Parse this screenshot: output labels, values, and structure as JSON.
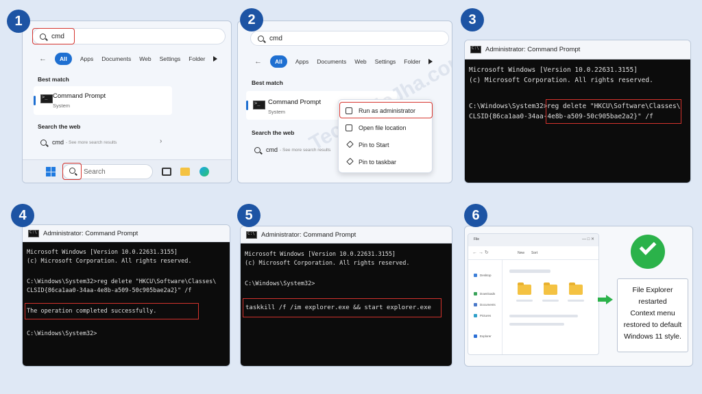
{
  "steps": [
    "1",
    "2",
    "3",
    "4",
    "5",
    "6"
  ],
  "search": {
    "query": "cmd",
    "filters": [
      "All",
      "Apps",
      "Documents",
      "Web",
      "Settings",
      "Folder"
    ],
    "best_match_label": "Best match",
    "result_title": "Command Prompt",
    "result_subtitle": "System",
    "search_web_label": "Search the web",
    "web_query": "cmd",
    "web_hint": "- See more search results",
    "taskbar_search_placeholder": "Search"
  },
  "context_menu": {
    "items": [
      "Run as administrator",
      "Open file location",
      "Pin to Start",
      "Pin to taskbar"
    ]
  },
  "watermark": "TechWaleJha.com",
  "terminal": {
    "title": "Administrator: Command Prompt",
    "version_line": "Microsoft Windows [Version 10.0.22631.3155]",
    "copyright_line": "(c) Microsoft Corporation. All rights reserved.",
    "prompt": "C:\\Windows\\System32>",
    "reg_cmd_line1": "reg delete \"HKCU\\Software\\Classes\\",
    "reg_cmd_line2": "CLSID{86ca1aa0-34aa-4e8b-a509-50c905bae2a2}\" /f",
    "reg_full_line1": "C:\\Windows\\System32>reg delete \"HKCU\\Software\\Classes\\",
    "success_line": "The operation completed successfully.",
    "taskkill_line": "taskkill /f /im explorer.exe && start explorer.exe"
  },
  "explorer": {
    "note_lines": [
      "File Explorer",
      "restarted",
      "Context menu",
      "restored to default",
      "Windows 11 style."
    ],
    "tab_label": "File",
    "toolbar_items": [
      "New",
      "Sort"
    ],
    "nav_items": [
      "Desktop",
      "Downloads",
      "Documents",
      "Pictures",
      "Explorer"
    ]
  },
  "colors": {
    "badge": "#1d54a4",
    "accent": "#1e6fd1",
    "highlight_box": "#d5332d",
    "success": "#2bb24a"
  }
}
